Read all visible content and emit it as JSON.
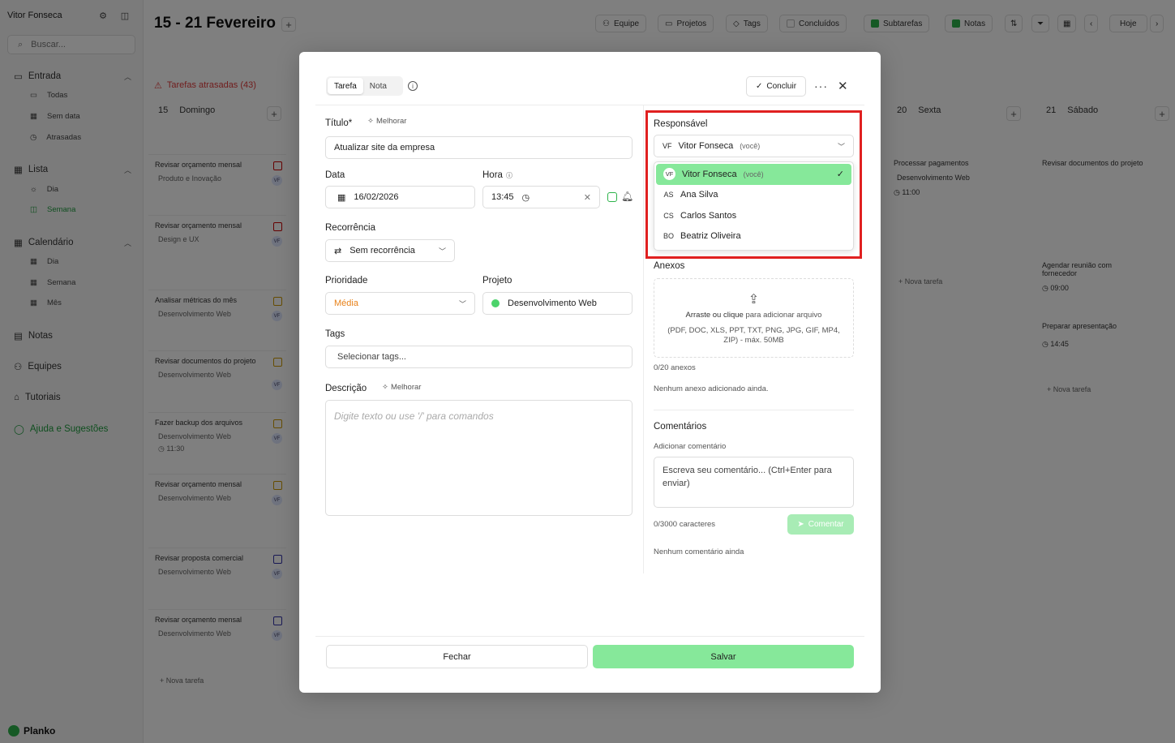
{
  "sidebar": {
    "user": "Vitor Fonseca",
    "search_placeholder": "Buscar...",
    "inbox": {
      "label": "Entrada",
      "items": [
        "Todas",
        "Sem data",
        "Atrasadas"
      ]
    },
    "list": {
      "label": "Lista",
      "items": [
        "Dia",
        "Semana"
      ]
    },
    "calendar": {
      "label": "Calendário",
      "items": [
        "Dia",
        "Semana",
        "Mês"
      ]
    },
    "notes": "Notas",
    "teams": "Equipes",
    "tutorials": "Tutoriais",
    "help": "Ajuda e Sugestões",
    "brand": "Planko"
  },
  "header": {
    "title": "15 - 21 Fevereiro",
    "buttons": {
      "team": "Equipe",
      "projects": "Projetos",
      "tags": "Tags",
      "done": "Concluídos",
      "subtasks": "Subtarefas",
      "notes": "Notas",
      "today": "Hoje"
    },
    "overdue": "Tarefas atrasadas (43)"
  },
  "days": {
    "d15": {
      "num": "15",
      "name": "Domingo"
    },
    "d20": {
      "num": "20",
      "name": "Sexta"
    },
    "d21": {
      "num": "21",
      "name": "Sábado"
    }
  },
  "board_cards": [
    {
      "title": "Revisar orçamento mensal",
      "project": "Produto e Inovação"
    },
    {
      "title": "Revisar orçamento mensal",
      "project": "Design e UX"
    },
    {
      "title": "Analisar métricas do mês",
      "project": "Desenvolvimento Web"
    },
    {
      "title": "Revisar documentos do projeto",
      "project": "Desenvolvimento Web"
    },
    {
      "title": "Fazer backup dos arquivos",
      "project": "Desenvolvimento Web",
      "time": "11:30"
    },
    {
      "title": "Revisar orçamento mensal",
      "project": "Desenvolvimento Web"
    },
    {
      "title": "Revisar proposta comercial",
      "project": "Desenvolvimento Web"
    },
    {
      "title": "Revisar orçamento mensal",
      "project": "Desenvolvimento Web"
    }
  ],
  "right_cards": {
    "fri": {
      "title": "Processar pagamentos",
      "project": "Desenvolvimento Web",
      "time": "11:00"
    },
    "sat1": {
      "title": "Revisar documentos do projeto"
    },
    "sat2": {
      "title": "Agendar reunião com fornecedor",
      "time": "09:00"
    },
    "sat3": {
      "title": "Preparar apresentação",
      "time": "14:45"
    }
  },
  "new_task": "Nova tarefa",
  "avatar_initials": "VF",
  "modal": {
    "tabs": [
      "Tarefa",
      "Nota"
    ],
    "complete": "Concluir",
    "title_label": "Título*",
    "improve": "Melhorar",
    "title_value": "Atualizar site da empresa",
    "date_label": "Data",
    "date_value": "16/02/2026",
    "time_label": "Hora",
    "time_value": "13:45",
    "recurrence_label": "Recorrência",
    "recurrence_value": "Sem recorrência",
    "priority_label": "Prioridade",
    "priority_value": "Média",
    "priority_color": "#e8821a",
    "project_label": "Projeto",
    "project_value": "Desenvolvimento Web",
    "tags_label": "Tags",
    "tags_placeholder": "Selecionar tags...",
    "desc_label": "Descrição",
    "desc_placeholder": "Digite texto ou use '/' para comandos",
    "responsible_label": "Responsável",
    "responsible_selected": {
      "initials": "VF",
      "name": "Vitor Fonseca",
      "you": "(você)"
    },
    "responsible_options": [
      {
        "initials": "VF",
        "name": "Vitor Fonseca",
        "you": "(você)"
      },
      {
        "initials": "AS",
        "name": "Ana Silva"
      },
      {
        "initials": "CS",
        "name": "Carlos Santos"
      },
      {
        "initials": "BO",
        "name": "Beatriz Oliveira"
      }
    ],
    "attachments_label": "Anexos",
    "upload_bold": "Arraste ou clique",
    "upload_rest": "para adicionar arquivo",
    "upload_formats": "(PDF, DOC, XLS, PPT, TXT, PNG, JPG, GIF, MP4, ZIP) - máx. 50MB",
    "attach_count": "0/20 anexos",
    "no_attach": "Nenhum anexo adicionado ainda.",
    "comments_label": "Comentários",
    "add_comment": "Adicionar comentário",
    "comment_placeholder": "Escreva seu comentário... (Ctrl+Enter para enviar)",
    "char_count": "0/3000 caracteres",
    "comment_btn": "Comentar",
    "no_comments": "Nenhum comentário ainda",
    "close_btn": "Fechar",
    "save_btn": "Salvar"
  },
  "colors": {
    "accent": "#86e89a",
    "brand": "#2db34a",
    "danger": "#e03b3b",
    "highlight": "#e02020"
  }
}
